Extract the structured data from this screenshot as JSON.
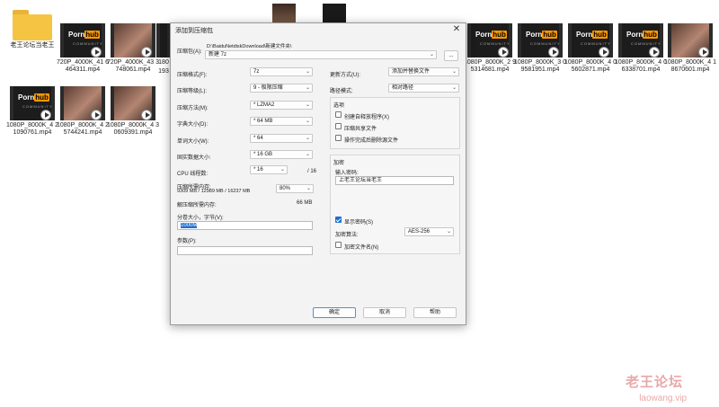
{
  "desktop": {
    "folder": {
      "label": "老王论坛当老王"
    },
    "row1_files": [
      {
        "label": "720P_4000K_41 6464311.mp4",
        "style": "ph"
      },
      {
        "label": "720P_4000K_43 3748061.mp4",
        "style": "video"
      },
      {
        "label": "1080P_8000K_2 95314681.mp4",
        "style": "ph"
      },
      {
        "label": "1080P_8000K_3 09581951.mp4",
        "style": "ph"
      },
      {
        "label": "1080P_8000K_4 05602871.mp4",
        "style": "ph"
      },
      {
        "label": "1080P_8000K_4 06338701.mp4",
        "style": "ph"
      },
      {
        "label": "1080P_8000K_4 18670601.mp4",
        "style": "video"
      }
    ],
    "row2_files": [
      {
        "label": "1080P_8000K_4 21090761.mp4",
        "style": "ph"
      },
      {
        "label": "1080P_8000K_4 25744241.mp4",
        "style": "video"
      },
      {
        "label": "1080P_8000K_4 30609391.mp4",
        "style": "video"
      }
    ],
    "partial_labels": {
      "a": "180",
      "b": "193"
    },
    "thumb_brand": {
      "porn": "Porn",
      "hub": "hub",
      "sub": "COMMUNITY"
    }
  },
  "dialog": {
    "title": "添加到压缩包",
    "archive_label": "压缩包(A):",
    "archive_path": "D:\\BaiduNetdiskDownload\\新建文件夹\\",
    "archive_name": "新建 7z",
    "browse_label": "...",
    "format_label": "压缩格式(F):",
    "format_value": "7z",
    "level_label": "压缩等级(L):",
    "level_value": "9 - 极限压缩",
    "method_label": "压缩方法(M):",
    "method_value": "* LZMA2",
    "dict_label": "字典大小(D):",
    "dict_value": "* 64 MB",
    "word_label": "单词大小(W):",
    "word_value": "* 64",
    "solid_label": "固实数据大小:",
    "solid_value": "* 16 GB",
    "threads_label": "CPU 线程数:",
    "threads_value": "* 16",
    "threads_total": "/ 16",
    "mem_label": "压缩所需内存:",
    "mem_detail": "9309 MB / 12989 MB / 16237 MB",
    "mem_percent": "80%",
    "decomp_label": "解压缩所需内存:",
    "decomp_value": "66 MB",
    "split_label": "分卷大小，字节(V):",
    "split_value": "1000M",
    "params_label": "参数(P):",
    "params_value": "",
    "update_label": "更新方式(U):",
    "update_value": "添加并替换文件",
    "pathmode_label": "路径模式:",
    "pathmode_value": "相对路径",
    "options_title": "选项",
    "opt_sfx": "创建自释放程序(X)",
    "opt_shared": "压缩共享文件",
    "opt_delete": "操作完成后删除源文件",
    "encrypt_title": "加密",
    "password_label": "输入密码:",
    "password_value": "上老王论坛当老王",
    "show_password": "显示密码(S)",
    "enc_method_label": "加密算法:",
    "enc_method_value": "AES-256",
    "encrypt_names": "加密文件名(N)",
    "ok": "确定",
    "cancel": "取消",
    "help": "帮助"
  },
  "watermark": {
    "cn": "老王论坛",
    "url": "laowang.vip"
  }
}
